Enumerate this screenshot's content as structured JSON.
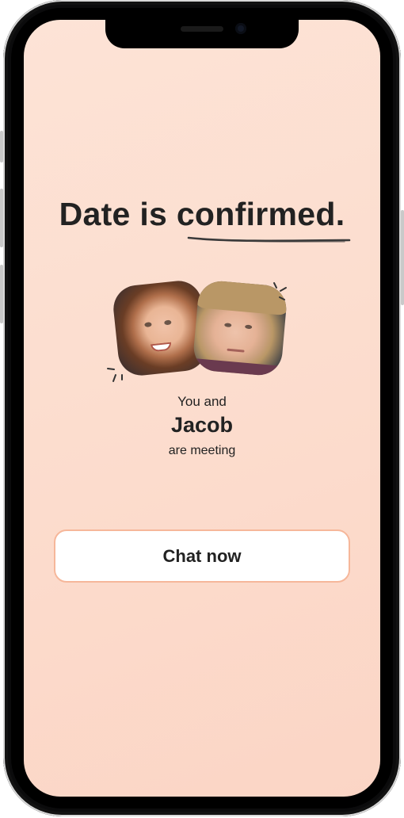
{
  "headline": {
    "prefix": "Date is ",
    "emphasis": "confirmed."
  },
  "match": {
    "intro": "You and",
    "name": "Jacob",
    "outro": "are meeting"
  },
  "actions": {
    "chat_label": "Chat now"
  },
  "theme": {
    "background": "#fcdccd",
    "accent_border": "#f6b79a",
    "text": "#222222"
  },
  "icons": {
    "sparkle": "sparkle-icon",
    "underline": "scribble-underline"
  }
}
